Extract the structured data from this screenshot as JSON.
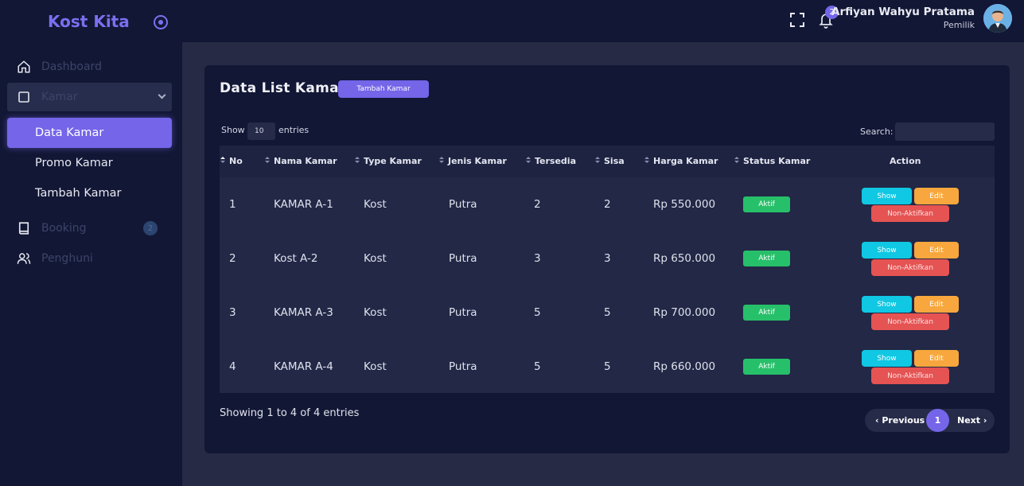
{
  "brand": "Kost Kita",
  "sidebar": {
    "items": [
      {
        "label": "Dashboard",
        "icon": "home-icon"
      },
      {
        "label": "Kamar",
        "icon": "square-icon"
      },
      {
        "label": "Booking",
        "icon": "book-icon",
        "badge": "2"
      },
      {
        "label": "Penghuni",
        "icon": "users-icon"
      }
    ],
    "submenu": [
      {
        "label": "Data Kamar",
        "active": true
      },
      {
        "label": "Promo Kamar"
      },
      {
        "label": "Tambah Kamar"
      }
    ]
  },
  "topbar": {
    "notification_count": "2",
    "user_name": "Arfiyan Wahyu Pratama",
    "user_role": "Pemilik"
  },
  "card": {
    "title": "Data List Kamar",
    "add_button": "Tambah Kamar",
    "show_label": "Show",
    "entries_value": "10",
    "entries_label": "entries",
    "search_label": "Search:"
  },
  "table": {
    "headers": [
      "No",
      "Nama Kamar",
      "Type Kamar",
      "Jenis Kamar",
      "Tersedia",
      "Sisa",
      "Harga Kamar",
      "Status Kamar",
      "Action"
    ],
    "rows": [
      {
        "no": "1",
        "nama": "KAMAR A-1",
        "type": "Kost",
        "jenis": "Putra",
        "tersedia": "2",
        "sisa": "2",
        "harga": "Rp 550.000",
        "status": "Aktif"
      },
      {
        "no": "2",
        "nama": "Kost A-2",
        "type": "Kost",
        "jenis": "Putra",
        "tersedia": "3",
        "sisa": "3",
        "harga": "Rp 650.000",
        "status": "Aktif"
      },
      {
        "no": "3",
        "nama": "KAMAR A-3",
        "type": "Kost",
        "jenis": "Putra",
        "tersedia": "5",
        "sisa": "5",
        "harga": "Rp 700.000",
        "status": "Aktif"
      },
      {
        "no": "4",
        "nama": "KAMAR A-4",
        "type": "Kost",
        "jenis": "Putra",
        "tersedia": "5",
        "sisa": "5",
        "harga": "Rp 660.000",
        "status": "Aktif"
      }
    ],
    "actions": {
      "show": "Show",
      "edit": "Edit",
      "deactivate": "Non-Aktifkan"
    }
  },
  "footer": {
    "showing": "Showing 1 to 4 of 4 entries",
    "previous": "Previous",
    "page": "1",
    "next": "Next"
  },
  "colors": {
    "accent": "#7465e9",
    "sidebar_bg": "#121735",
    "page_bg": "#262a44",
    "status_active": "#27c06a",
    "show_btn": "#10c8e3",
    "edit_btn": "#f7a73d",
    "deactivate_btn": "#e55353"
  }
}
